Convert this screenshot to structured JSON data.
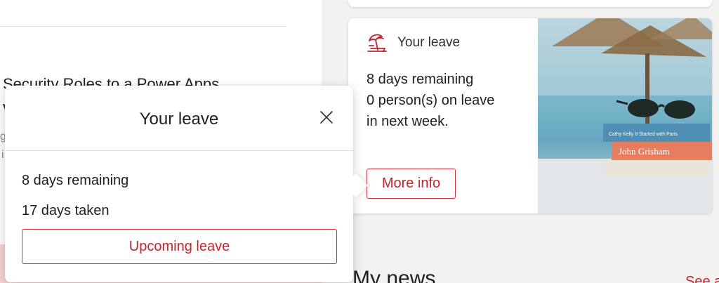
{
  "background_article": {
    "title_line1": "Security Roles to a Power Apps",
    "title_line2": "v",
    "faint_1": "g",
    "faint_2": "i"
  },
  "leave_card": {
    "header_title": "Your leave",
    "header_icon": "umbrella-beach-icon",
    "summary_line1": "8 days remaining",
    "summary_line2": "0 person(s) on leave",
    "summary_line3": "in next week.",
    "more_info_label": "More info",
    "image_book_1": "Cathy Kelly  It Started with Paris",
    "image_book_2": "John Grisham"
  },
  "news": {
    "title": "My news",
    "see_all": "See a"
  },
  "popup": {
    "title": "Your leave",
    "close_icon": "close-icon",
    "days_remaining": "8 days remaining",
    "days_taken": "17 days taken",
    "upcoming_label": "Upcoming leave"
  },
  "colors": {
    "accent": "#c4262e",
    "border_accent": "#d13438",
    "page_bg": "#f3f2f1",
    "card_bg": "#ffffff"
  }
}
